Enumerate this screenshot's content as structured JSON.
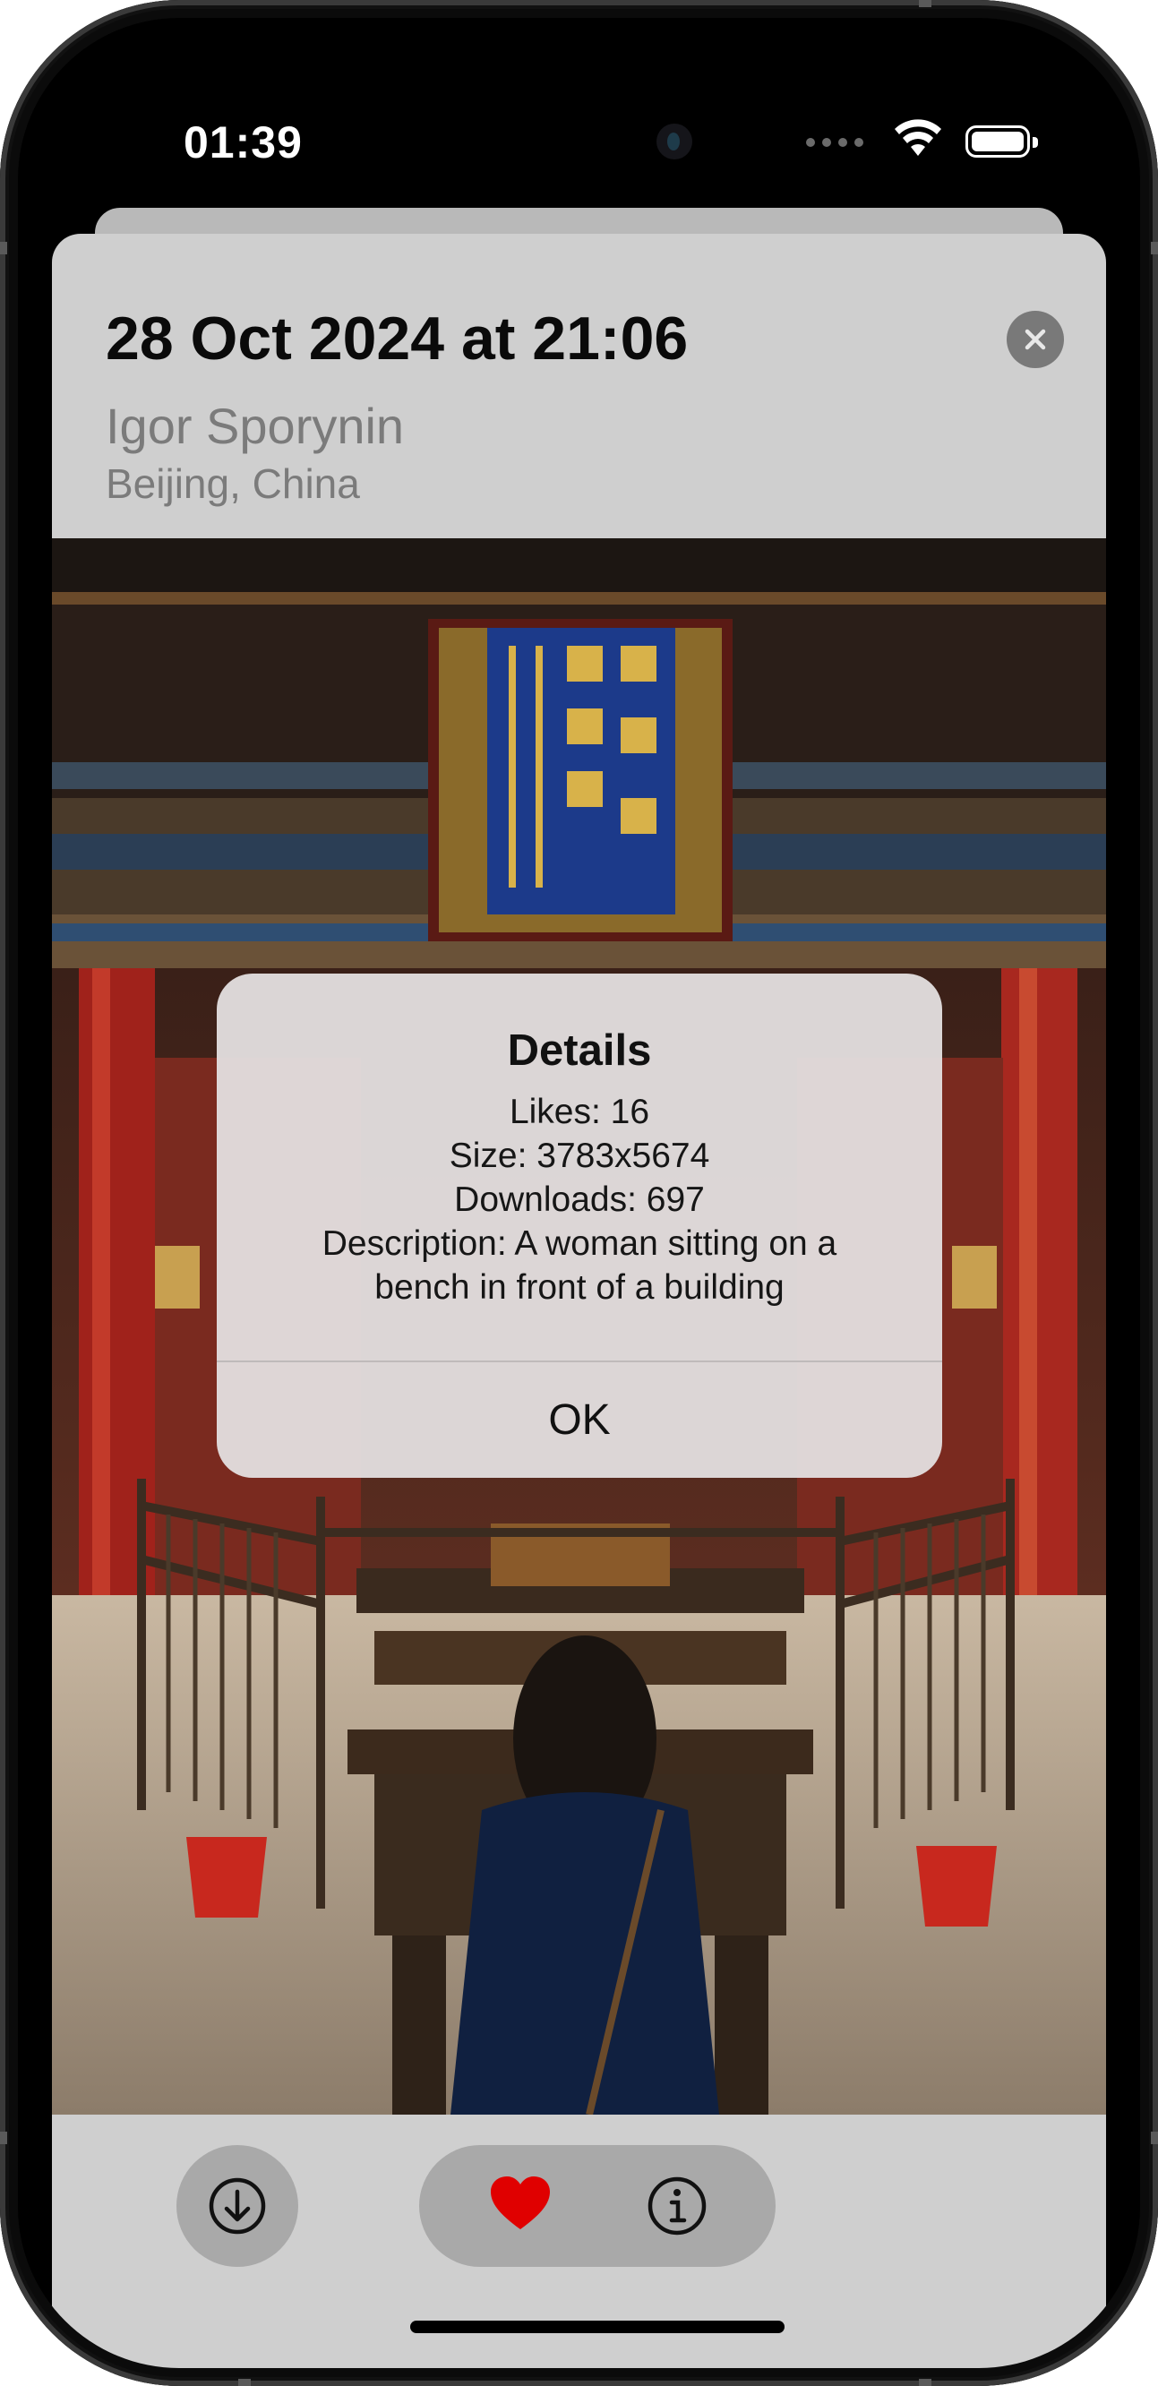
{
  "status_bar": {
    "time": "01:39"
  },
  "header": {
    "title": "28 Oct 2024 at 21:06",
    "author": "Igor Sporynin",
    "location": "Beijing, China"
  },
  "photo": {
    "subject": "photo"
  },
  "alert": {
    "title": "Details",
    "lines": [
      "Likes: 16",
      "Size: 3783x5674",
      "Downloads: 697",
      "Description: A woman sitting on a",
      "bench in front of a building"
    ],
    "ok_label": "OK"
  },
  "toolbar": {
    "download_icon": "download-icon",
    "like_icon": "heart-icon",
    "info_icon": "info-icon"
  },
  "colors": {
    "heart": "#e00000",
    "sheet": "#cfcfcf",
    "button_bg": "#a9a9a9"
  }
}
